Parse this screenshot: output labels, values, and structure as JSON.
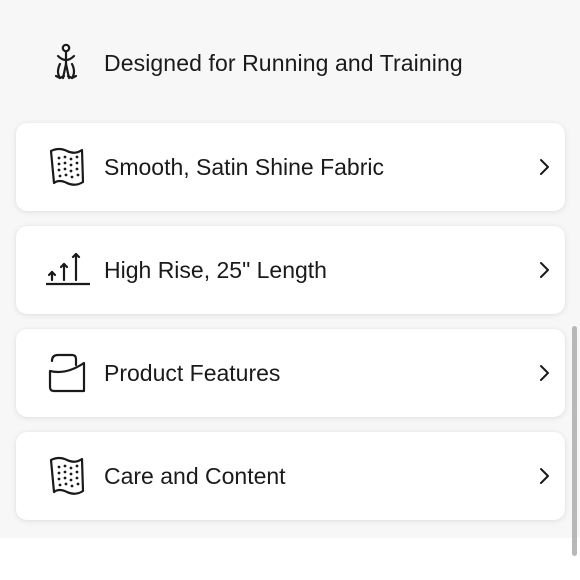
{
  "header": {
    "label": "Designed for Running and Training",
    "icon": "runner-icon"
  },
  "items": [
    {
      "label": "Smooth, Satin Shine Fabric",
      "icon": "fabric-icon"
    },
    {
      "label": "High Rise, 25\" Length",
      "icon": "rise-length-icon"
    },
    {
      "label": "Product Features",
      "icon": "pocket-icon"
    },
    {
      "label": "Care and Content",
      "icon": "fabric-icon"
    }
  ],
  "colors": {
    "background": "#f7f7f7",
    "card": "#ffffff",
    "text": "#1a1a1a",
    "scrollbar": "#b8b8b8"
  }
}
